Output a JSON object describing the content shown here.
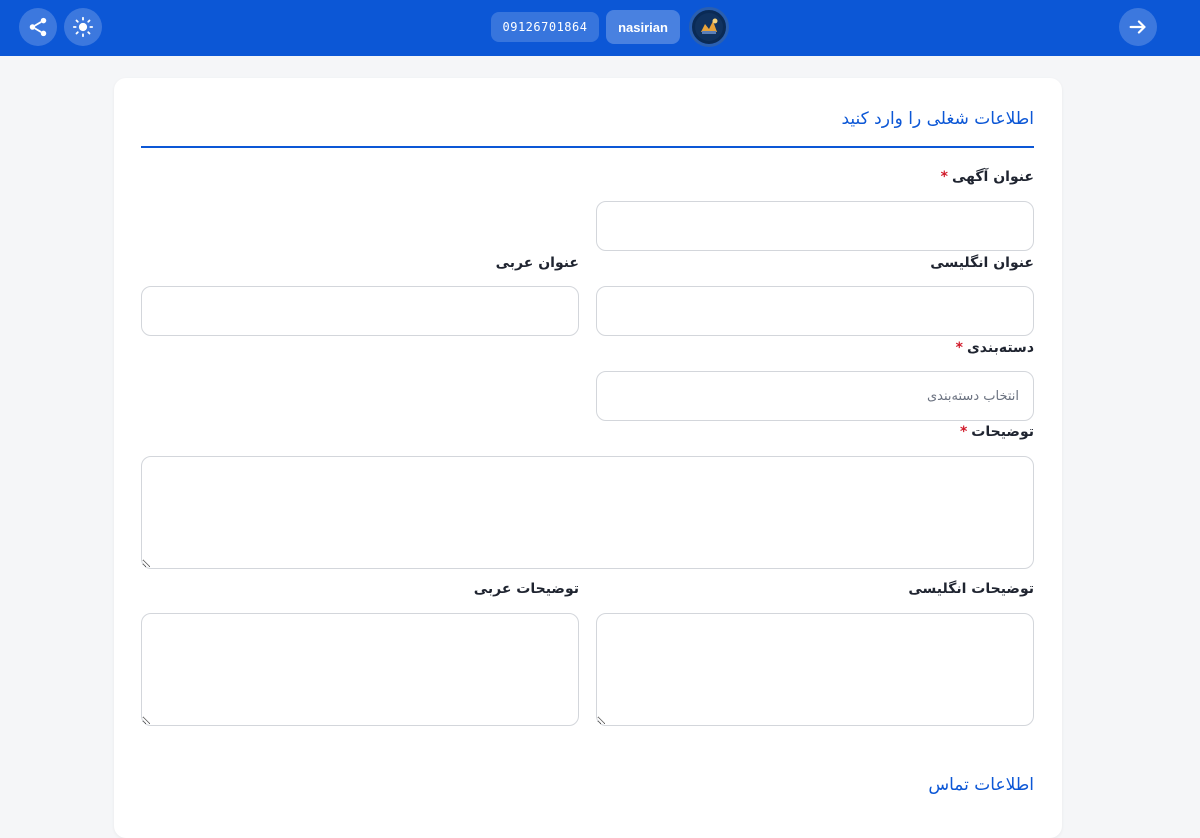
{
  "header": {
    "phone": "09126701864",
    "username": "nasirian",
    "icons": {
      "share": "share-icon",
      "theme": "sun-icon",
      "back": "arrow-right-icon",
      "avatar": "avatar-image"
    },
    "colors": {
      "bar": "#0c57d6",
      "accent": "#0c57d6",
      "required": "#d11a2a"
    }
  },
  "form": {
    "section_title": "اطلاعات شغلی را وارد کنید",
    "fields": {
      "title": {
        "label": "عنوان آگهی",
        "required_mark": "*",
        "value": ""
      },
      "title_en": {
        "label": "عنوان انگلیسی",
        "value": ""
      },
      "title_ar": {
        "label": "عنوان عربی",
        "value": ""
      },
      "category": {
        "label": "دسته‌بندی",
        "required_mark": "*",
        "placeholder": "انتخاب دسته‌بندی"
      },
      "description": {
        "label": "توضیحات",
        "required_mark": "*",
        "value": ""
      },
      "description_en": {
        "label": "توضیحات انگلیسی",
        "value": ""
      },
      "description_ar": {
        "label": "توضیحات عربی",
        "value": ""
      }
    },
    "contact_title": "اطلاعات تماس"
  }
}
